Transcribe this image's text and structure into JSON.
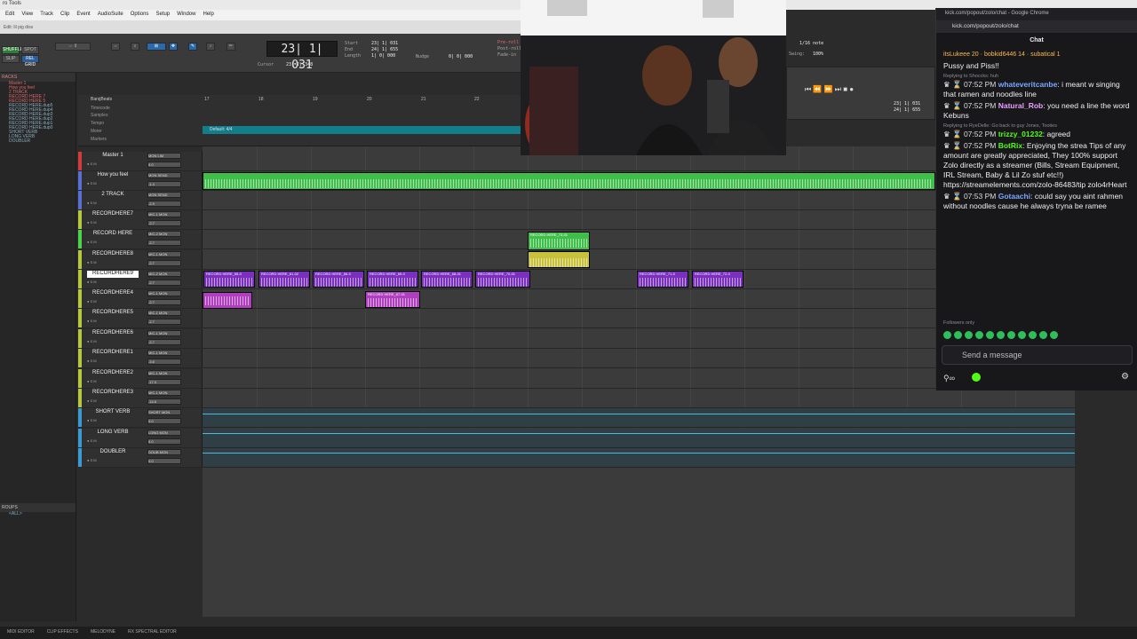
{
  "window": {
    "title": "ro Tools",
    "edit_title": "Edit: lil pig diss"
  },
  "menu": [
    "Edit",
    "View",
    "Track",
    "Clip",
    "Event",
    "AudioSuite",
    "Options",
    "Setup",
    "Window",
    "Help"
  ],
  "toolbar": {
    "counter": "23| 1| 031",
    "cursor_label": "Cursor",
    "cursor_value": "23| 2| 348",
    "start_label": "Start",
    "end_label": "End",
    "length_label": "Length",
    "start_value": "23| 1| 031",
    "end_value": "24| 1| 655",
    "length_value": "1| 0| 000",
    "nudge_label": "Nudge",
    "nudge_value": "0| 0| 000",
    "preroll_label": "Pre-roll",
    "postroll_label": "Post-roll",
    "fadein_label": "Fade-in",
    "grid_value": "1/16 note",
    "swing_label": "Swing:",
    "swing_value": "100%",
    "shuffle_label": "SHUFFLE",
    "spot_label": "SPOT",
    "slip_label": "SLIP",
    "grid_mode_label": "REL GRID"
  },
  "tracklist": {
    "header": "RACKS",
    "items": [
      "Master 1",
      "How you feel",
      "2 TRACK",
      "RECORD HERE 7",
      "RECORD HERE 5",
      "RECORD HERE.dup5",
      "RECORD HERE.dup4",
      "RECORD HERE.dup3",
      "RECORD HERE.dup2",
      "RECORD HERE.dup1",
      "RECORD HERE.dup0",
      "SHORT VERB",
      "LONG VERB",
      "DOUBLER"
    ]
  },
  "groups": {
    "header": "ROUPS",
    "item": "<ALL>"
  },
  "rulers": {
    "session": "BarsjBeats",
    "labels": [
      "Timecode",
      "Samples",
      "Tempo",
      "Meter",
      "Markers"
    ],
    "bar_numbers": [
      "17",
      "18",
      "19",
      "20",
      "21",
      "22",
      "23"
    ],
    "tempo_text": "Default: 4/4"
  },
  "tracks": [
    {
      "name": "Master 1",
      "color": "#d63a3a",
      "plugin": "MON LIM",
      "vol": "volume",
      "val": "0.0"
    },
    {
      "name": "How you feel",
      "color": "#5a6fd6",
      "plugin": "MON SEND",
      "vol": "vol",
      "val": "-1.4"
    },
    {
      "name": "2 TRACK",
      "color": "#5a6fd6",
      "plugin": "MON SEND",
      "vol": "vol",
      "val": "-2.9"
    },
    {
      "name": "RECORDHERE7",
      "color": "#b7c93a",
      "plugin": "MIC-1 MON",
      "vol": "vol",
      "val": "-2.7"
    },
    {
      "name": "RECORD HERE",
      "color": "#4ad64a",
      "plugin": "MIC-2 MON",
      "vol": "vol",
      "val": "-2.7"
    },
    {
      "name": "RECORDHERE8",
      "color": "#b7c93a",
      "plugin": "MIC-1 MON",
      "vol": "vol",
      "val": "-2.7"
    },
    {
      "name": "RECORDHERE9",
      "color": "#b7c93a",
      "plugin": "MIC-2 MON",
      "vol": "vol",
      "val": "-2.7"
    },
    {
      "name": "RECORDHERE4",
      "color": "#b7c93a",
      "plugin": "MIC-1 MON",
      "vol": "vol",
      "val": "-2.7"
    },
    {
      "name": "RECORDHERE5",
      "color": "#b7c93a",
      "plugin": "MIC-1 MON",
      "vol": "vol",
      "val": "-2.7"
    },
    {
      "name": "RECORDHERE6",
      "color": "#b7c93a",
      "plugin": "MIC-1 MON",
      "vol": "vol",
      "val": "-2.7"
    },
    {
      "name": "RECORDHERE1",
      "color": "#b7c93a",
      "plugin": "MIC-1 MON",
      "vol": "vol",
      "val": "-3.6"
    },
    {
      "name": "RECORDHERE2",
      "color": "#b7c93a",
      "plugin": "MIC-1 MON",
      "vol": "vol",
      "val": "-17.0"
    },
    {
      "name": "RECORDHERE3",
      "color": "#b7c93a",
      "plugin": "MIC-1 MON",
      "vol": "vol",
      "val": "-14.6"
    },
    {
      "name": "SHORT VERB",
      "color": "#3a9ad6",
      "plugin": "SHORT MON",
      "vol": "vol",
      "val": "0.0"
    },
    {
      "name": "LONG VERB",
      "color": "#3a9ad6",
      "plugin": "LONG MON",
      "vol": "vol",
      "val": "0.0"
    },
    {
      "name": "DOUBLER",
      "color": "#3a9ad6",
      "plugin": "DOUB MON",
      "vol": "vol",
      "val": "0.0"
    }
  ],
  "clips": {
    "record_here_top": "RECORD HERE_73-01",
    "row7": [
      "RECORD HERE_65-0",
      "RECORD HERE_61-02",
      "RECORD HERE_66-0",
      "RECORD HERE_69-0",
      "RECORD HERE_68-01",
      "RECORD HERE_70-01",
      "RECORD HERE_71-0",
      "RECORD HERE_72-0"
    ],
    "row8": "RECORD HERE_67-01",
    "gain_label": "0 dB"
  },
  "chat": {
    "tab_title": "kick.com/popout/zolo/chat - Google Chrome",
    "url": "kick.com/popout/zolo/chat",
    "title": "Chat",
    "top_badges": [
      "itsLukeee 20",
      "bobkid6446 14",
      "subatical 1"
    ],
    "top_line": "Pussy and Piss!!",
    "messages": [
      {
        "reply": "Replying to Shoccks: huh",
        "time": "07:52 PM",
        "user": "whateveritcanbe",
        "user_color": "#7ba7ff",
        "text": "i meant w singing that ramen and noodles line"
      },
      {
        "reply": "",
        "time": "07:52 PM",
        "user": "Natural_Rob",
        "user_color": "#e8a0ff",
        "text": "you need a line the word Kebuns"
      },
      {
        "reply": "Replying to RyeDelle: Go back to guy Jones, Tooties",
        "time": "07:52 PM",
        "user": "trizzy_01232",
        "user_color": "#53fc18",
        "text": "agreed"
      },
      {
        "reply": "",
        "time": "07:52 PM",
        "user": "BotRix",
        "user_color": "#53fc18",
        "text": "Enjoying the strea Tips of any amount are greatly appreciated, They 100% support Zolo directly as a streamer (Bills, Stream Equipment, IRL Stream, Baby & Lil Zo stuf etc!!) https://streamelements.com/zolo-86483/tip zolo4rHeart"
      },
      {
        "reply": "",
        "time": "07:53 PM",
        "user": "Gotaachi",
        "user_color": "#7ba7ff",
        "text": "could say you aint rahmen without noodles cause he always tryna be ramee"
      }
    ],
    "followers_only": "Followers only",
    "send_placeholder": "Send a message"
  },
  "bottom_tabs": [
    "MIDI EDITOR",
    "CLIP EFFECTS",
    "MELODYNE",
    "RX SPECTRAL EDITOR"
  ]
}
